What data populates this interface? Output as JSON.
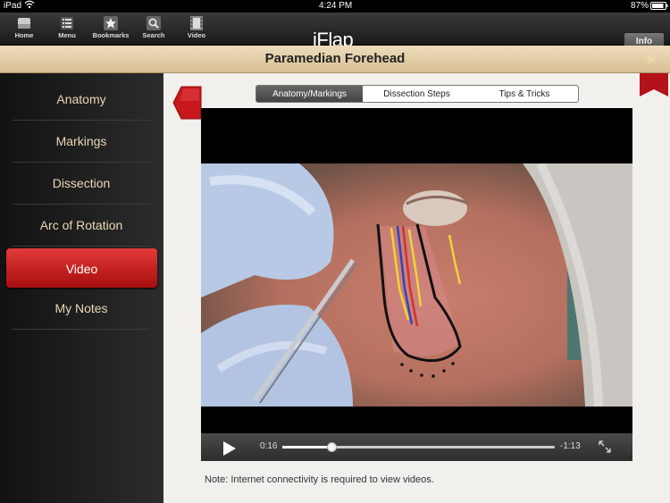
{
  "status_bar": {
    "device": "iPad",
    "time": "4:24 PM",
    "battery": "87%",
    "icons": [
      "wifi-icon",
      "battery-icon"
    ]
  },
  "toolbar": {
    "buttons": [
      {
        "label": "Home",
        "icon": "home-icon"
      },
      {
        "label": "Menu",
        "icon": "menu-icon"
      },
      {
        "label": "Bookmarks",
        "icon": "star-icon"
      },
      {
        "label": "Search",
        "icon": "search-icon"
      },
      {
        "label": "Video",
        "icon": "film-icon"
      }
    ],
    "app_logo": "iFlap",
    "info_button": "Info"
  },
  "page": {
    "title": "Paramedian Forehead",
    "bookmark_icon": "star-icon"
  },
  "sidebar": {
    "items": [
      {
        "label": "Anatomy",
        "active": false
      },
      {
        "label": "Markings",
        "active": false
      },
      {
        "label": "Dissection",
        "active": false
      },
      {
        "label": "Arc of Rotation",
        "active": false
      },
      {
        "label": "Video",
        "active": true
      },
      {
        "label": "My Notes",
        "active": false
      }
    ]
  },
  "segments": {
    "tabs": [
      "Anatomy/Markings",
      "Dissection Steps",
      "Tips & Tricks"
    ],
    "selected": "Anatomy/Markings"
  },
  "video_player": {
    "elapsed": "0:16",
    "remaining": "-1:13",
    "progress_fraction": 0.18
  },
  "note": "Note:  Internet connectivity is required to view videos.",
  "colors": {
    "accent_red": "#c8171d",
    "title_bar": "#e4cea6",
    "sidebar_text": "#e9d8b6"
  }
}
